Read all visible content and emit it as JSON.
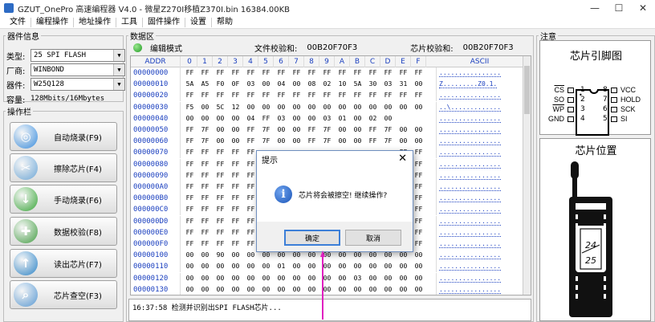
{
  "window": {
    "title": "GZUT_OnePro 高速编程器 V4.0 - 微星Z270I移植Z370I.bin  16384.00KB",
    "controls": [
      "—",
      "☐",
      "✕"
    ]
  },
  "menu": [
    "文件",
    "编程操作",
    "地址操作",
    "工具",
    "固件操作",
    "设置",
    "帮助"
  ],
  "device_info": {
    "legend": "器件信息",
    "type_label": "类型:",
    "type_value": "25 SPI FLASH",
    "vendor_label": "厂商:",
    "vendor_value": "WINBOND",
    "device_label": "器件:",
    "device_value": "W25Q128",
    "capacity_label": "容量:",
    "capacity_value": "128Mbits/16Mbytes"
  },
  "operations": {
    "legend": "操作栏",
    "buttons": [
      {
        "label": "自动烧录(F9)",
        "icon": "globe-icon",
        "color": "#3b8fe0",
        "glyph": "◎"
      },
      {
        "label": "擦除芯片(F4)",
        "icon": "scissors-icon",
        "color": "#6fa9d9",
        "glyph": "✂"
      },
      {
        "label": "手动烧录(F6)",
        "icon": "download-icon",
        "color": "#3aa83a",
        "glyph": "↓"
      },
      {
        "label": "数据校验(F8)",
        "icon": "verify-icon",
        "color": "#46a046",
        "glyph": "✚"
      },
      {
        "label": "读出芯片(F7)",
        "icon": "upload-icon",
        "color": "#2f86c9",
        "glyph": "↑"
      },
      {
        "label": "芯片查空(F3)",
        "icon": "search-icon",
        "color": "#5b9bd5",
        "glyph": "⌕"
      }
    ]
  },
  "data_area": {
    "legend": "数据区",
    "mode": "编辑模式",
    "file_checksum_label": "文件校验和:",
    "file_checksum": "00B20F70F3",
    "chip_checksum_label": "芯片校验和:",
    "chip_checksum": "00B20F70F3",
    "headers": [
      "ADDR",
      "0",
      "1",
      "2",
      "3",
      "4",
      "5",
      "6",
      "7",
      "8",
      "9",
      "A",
      "B",
      "C",
      "D",
      "E",
      "F",
      "ASCII"
    ],
    "rows": [
      {
        "addr": "00000000",
        "bytes": [
          "FF",
          "FF",
          "FF",
          "FF",
          "FF",
          "FF",
          "FF",
          "FF",
          "FF",
          "FF",
          "FF",
          "FF",
          "FF",
          "FF",
          "FF",
          "FF"
        ],
        "ascii": "................"
      },
      {
        "addr": "00000010",
        "bytes": [
          "5A",
          "A5",
          "F0",
          "0F",
          "03",
          "00",
          "04",
          "00",
          "08",
          "02",
          "10",
          "5A",
          "30",
          "03",
          "31",
          "00"
        ],
        "ascii": "Z.........Z0.1."
      },
      {
        "addr": "00000020",
        "bytes": [
          "FF",
          "FF",
          "FF",
          "FF",
          "FF",
          "FF",
          "FF",
          "FF",
          "FF",
          "FF",
          "FF",
          "FF",
          "FF",
          "FF",
          "FF",
          "FF"
        ],
        "ascii": "................"
      },
      {
        "addr": "00000030",
        "bytes": [
          "F5",
          "00",
          "5C",
          "12",
          "00",
          "00",
          "00",
          "00",
          "00",
          "00",
          "00",
          "00",
          "00",
          "00",
          "00",
          "00"
        ],
        "ascii": "..\\............."
      },
      {
        "addr": "00000040",
        "bytes": [
          "00",
          "00",
          "00",
          "00",
          "04",
          "FF",
          "03",
          "00",
          "00",
          "03",
          "01",
          "00",
          "02",
          "00",
          "",
          ""
        ],
        "ascii": "................"
      },
      {
        "addr": "00000050",
        "bytes": [
          "FF",
          "7F",
          "00",
          "00",
          "FF",
          "7F",
          "00",
          "00",
          "FF",
          "7F",
          "00",
          "00",
          "FF",
          "7F",
          "00",
          "00"
        ],
        "ascii": "................"
      },
      {
        "addr": "00000060",
        "bytes": [
          "FF",
          "7F",
          "00",
          "00",
          "FF",
          "7F",
          "00",
          "00",
          "FF",
          "7F",
          "00",
          "00",
          "FF",
          "7F",
          "00",
          "00"
        ],
        "ascii": "................"
      },
      {
        "addr": "00000070",
        "bytes": [
          "FF",
          "FF",
          "FF",
          "FF",
          "FF",
          "",
          "",
          "",
          "",
          "",
          "",
          "",
          "",
          "",
          "FF",
          "FF"
        ],
        "ascii": "................"
      },
      {
        "addr": "00000080",
        "bytes": [
          "FF",
          "FF",
          "FF",
          "FF",
          "FF",
          "",
          "",
          "",
          "",
          "",
          "",
          "",
          "",
          "",
          "FF",
          "FF"
        ],
        "ascii": "................"
      },
      {
        "addr": "00000090",
        "bytes": [
          "FF",
          "FF",
          "FF",
          "FF",
          "FF",
          "",
          "",
          "",
          "",
          "",
          "",
          "",
          "",
          "",
          "FF",
          "FF"
        ],
        "ascii": "................"
      },
      {
        "addr": "000000A0",
        "bytes": [
          "FF",
          "FF",
          "FF",
          "FF",
          "FF",
          "",
          "",
          "",
          "",
          "",
          "",
          "",
          "",
          "",
          "FF",
          "FF"
        ],
        "ascii": "................"
      },
      {
        "addr": "000000B0",
        "bytes": [
          "FF",
          "FF",
          "FF",
          "FF",
          "FF",
          "",
          "",
          "",
          "",
          "",
          "",
          "",
          "",
          "",
          "FF",
          "FF"
        ],
        "ascii": "................"
      },
      {
        "addr": "000000C0",
        "bytes": [
          "FF",
          "FF",
          "FF",
          "FF",
          "FF",
          "",
          "",
          "",
          "",
          "",
          "",
          "",
          "",
          "",
          "FF",
          "FF"
        ],
        "ascii": "................"
      },
      {
        "addr": "000000D0",
        "bytes": [
          "FF",
          "FF",
          "FF",
          "FF",
          "FF",
          "",
          "",
          "",
          "",
          "",
          "",
          "",
          "",
          "",
          "FF",
          "FF"
        ],
        "ascii": "................"
      },
      {
        "addr": "000000E0",
        "bytes": [
          "FF",
          "FF",
          "FF",
          "FF",
          "FF",
          "",
          "",
          "",
          "",
          "",
          "",
          "",
          "",
          "",
          "FF",
          "FF"
        ],
        "ascii": "................"
      },
      {
        "addr": "000000F0",
        "bytes": [
          "FF",
          "FF",
          "FF",
          "FF",
          "FF",
          "",
          "",
          "",
          "",
          "",
          "",
          "",
          "",
          "",
          "FF",
          "FF"
        ],
        "ascii": "................"
      },
      {
        "addr": "00000100",
        "bytes": [
          "00",
          "00",
          "90",
          "00",
          "00",
          "00",
          "00",
          "00",
          "00",
          "00",
          "00",
          "00",
          "00",
          "00",
          "00",
          "00"
        ],
        "ascii": "................"
      },
      {
        "addr": "00000110",
        "bytes": [
          "00",
          "00",
          "00",
          "00",
          "00",
          "00",
          "01",
          "00",
          "00",
          "00",
          "00",
          "00",
          "00",
          "00",
          "00",
          "00"
        ],
        "ascii": "................"
      },
      {
        "addr": "00000120",
        "bytes": [
          "00",
          "00",
          "00",
          "00",
          "00",
          "00",
          "00",
          "00",
          "00",
          "00",
          "00",
          "03",
          "00",
          "00",
          "00",
          "00"
        ],
        "ascii": "................"
      },
      {
        "addr": "00000130",
        "bytes": [
          "00",
          "00",
          "00",
          "00",
          "00",
          "00",
          "00",
          "00",
          "00",
          "00",
          "00",
          "00",
          "00",
          "00",
          "00",
          "00"
        ],
        "ascii": "................"
      }
    ],
    "log": "16:37:58  检测并识别出SPI FLASH芯片..."
  },
  "dialog": {
    "title": "提示",
    "message": "芯片将会被擦空! 继续操作?",
    "ok": "确定",
    "cancel": "取消",
    "close": "✕"
  },
  "notes": {
    "legend": "注意",
    "pinout_title": "芯片引脚图",
    "position_title": "芯片位置",
    "pins_left": [
      "CS",
      "SO",
      "WP",
      "GND"
    ],
    "pins_left_nums": [
      "1",
      "2",
      "3",
      "4"
    ],
    "pins_right": [
      "VCC",
      "HOLD",
      "SCK",
      "SI"
    ],
    "pins_right_nums": [
      "8",
      "7",
      "6",
      "5"
    ],
    "socket_label_top": "24",
    "socket_label_bottom": "25"
  },
  "colors": {
    "hex_blue": "#1a3fbf",
    "annotation_arrow": "#e020c0"
  }
}
